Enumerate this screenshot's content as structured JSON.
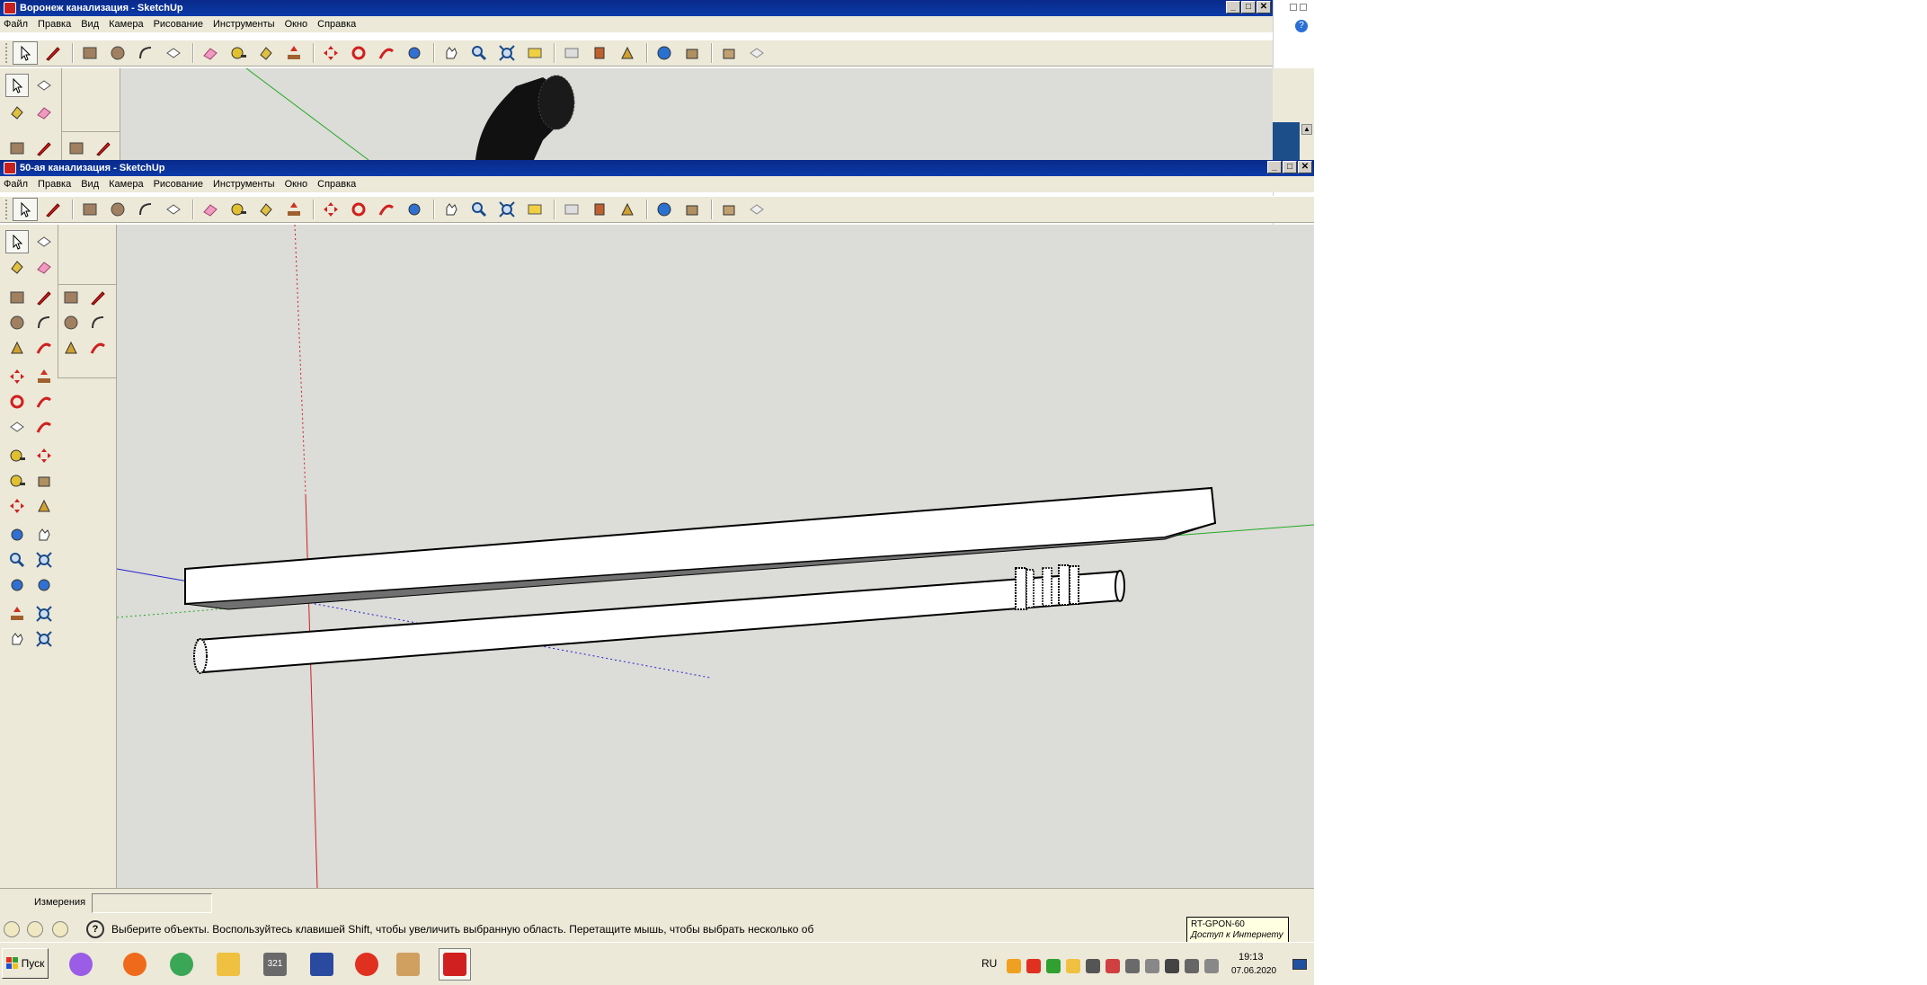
{
  "window_back": {
    "title": "Воронеж канализация - SketchUp",
    "menus": [
      "Файл",
      "Правка",
      "Вид",
      "Камера",
      "Рисование",
      "Инструменты",
      "Окно",
      "Справка"
    ]
  },
  "window_front": {
    "title": "50-ая канализация - SketchUp",
    "menus": [
      "Файл",
      "Правка",
      "Вид",
      "Камера",
      "Рисование",
      "Инструменты",
      "Окно",
      "Справка"
    ]
  },
  "window_buttons": {
    "minimize": "_",
    "maximize": "□",
    "close": "✕"
  },
  "toolbar": {
    "icons": [
      "select-icon",
      "pencil-icon",
      "rectangle-icon",
      "circle-icon",
      "arc-icon",
      "make-component-icon",
      "eraser-icon",
      "tape-measure-icon",
      "paint-bucket-icon",
      "push-pull-icon",
      "move-icon",
      "rotate-icon",
      "follow-me-icon",
      "orbit-icon",
      "pan-icon",
      "zoom-icon",
      "zoom-extents-icon",
      "add-location-icon",
      "toggle-terrain-icon",
      "get-models-icon",
      "share-model-icon",
      "photo-textures-icon",
      "get-models-3d-icon",
      "share-component-icon",
      "warehouse-icon"
    ]
  },
  "measurements": {
    "label": "Измерения",
    "value": ""
  },
  "status": {
    "text": "Выберите объекты. Воспользуйтесь клавишей Shift, чтобы увеличить выбранную область. Перетащите мышь, чтобы выбрать несколько об"
  },
  "tooltip": {
    "line1": "RT-GPON-60",
    "line2": "Доступ к Интернету"
  },
  "taskbar": {
    "start_label": "Пуск",
    "language": "RU",
    "time": "19:13",
    "date": "07.06.2020",
    "calendar_number": "321",
    "apps": [
      "alice-icon",
      "firefox-icon",
      "chrome-icon",
      "file-explorer-icon",
      "media-icon",
      "save-icon",
      "yandex-icon",
      "paint-icon",
      "sketchup-icon"
    ]
  },
  "colors": {
    "axis_red": "#cc2222",
    "axis_green": "#22aa22",
    "axis_blue": "#2222cc",
    "viewport_bg": "#dcdcd8",
    "title_blue": "#0b3aa8"
  }
}
